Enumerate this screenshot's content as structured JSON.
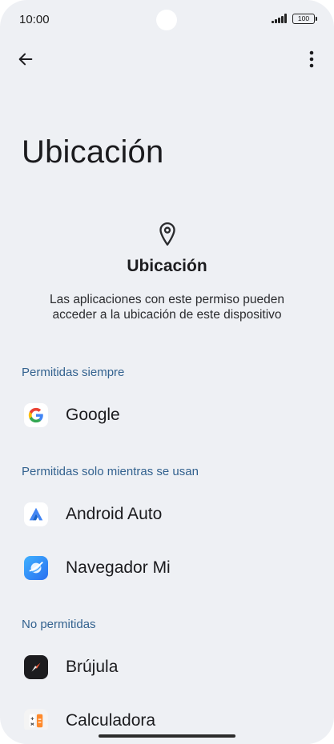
{
  "status": {
    "time": "10:00",
    "battery": "100"
  },
  "header": {
    "back_icon": "arrow-left-icon",
    "more_icon": "more-vertical-icon",
    "large_title": "Ubicación"
  },
  "permission": {
    "icon": "location-pin-icon",
    "title": "Ubicación",
    "description": "Las aplicaciones con este permiso pueden acceder a la ubicación de este dispositivo"
  },
  "groups": {
    "always": {
      "label": "Permitidas siempre",
      "apps": [
        {
          "name": "Google",
          "icon": "google-icon"
        }
      ]
    },
    "while_in_use": {
      "label": "Permitidas solo mientras se usan",
      "apps": [
        {
          "name": "Android Auto",
          "icon": "android-auto-icon"
        },
        {
          "name": "Navegador Mi",
          "icon": "mi-browser-icon"
        }
      ]
    },
    "denied": {
      "label": "No permitidas",
      "apps": [
        {
          "name": "Brújula",
          "icon": "compass-icon"
        },
        {
          "name": "Calculadora",
          "icon": "calculator-icon"
        }
      ]
    }
  },
  "colors": {
    "background": "#eef0f4",
    "group_label": "#33628f",
    "text_primary": "#1b1b1e"
  }
}
